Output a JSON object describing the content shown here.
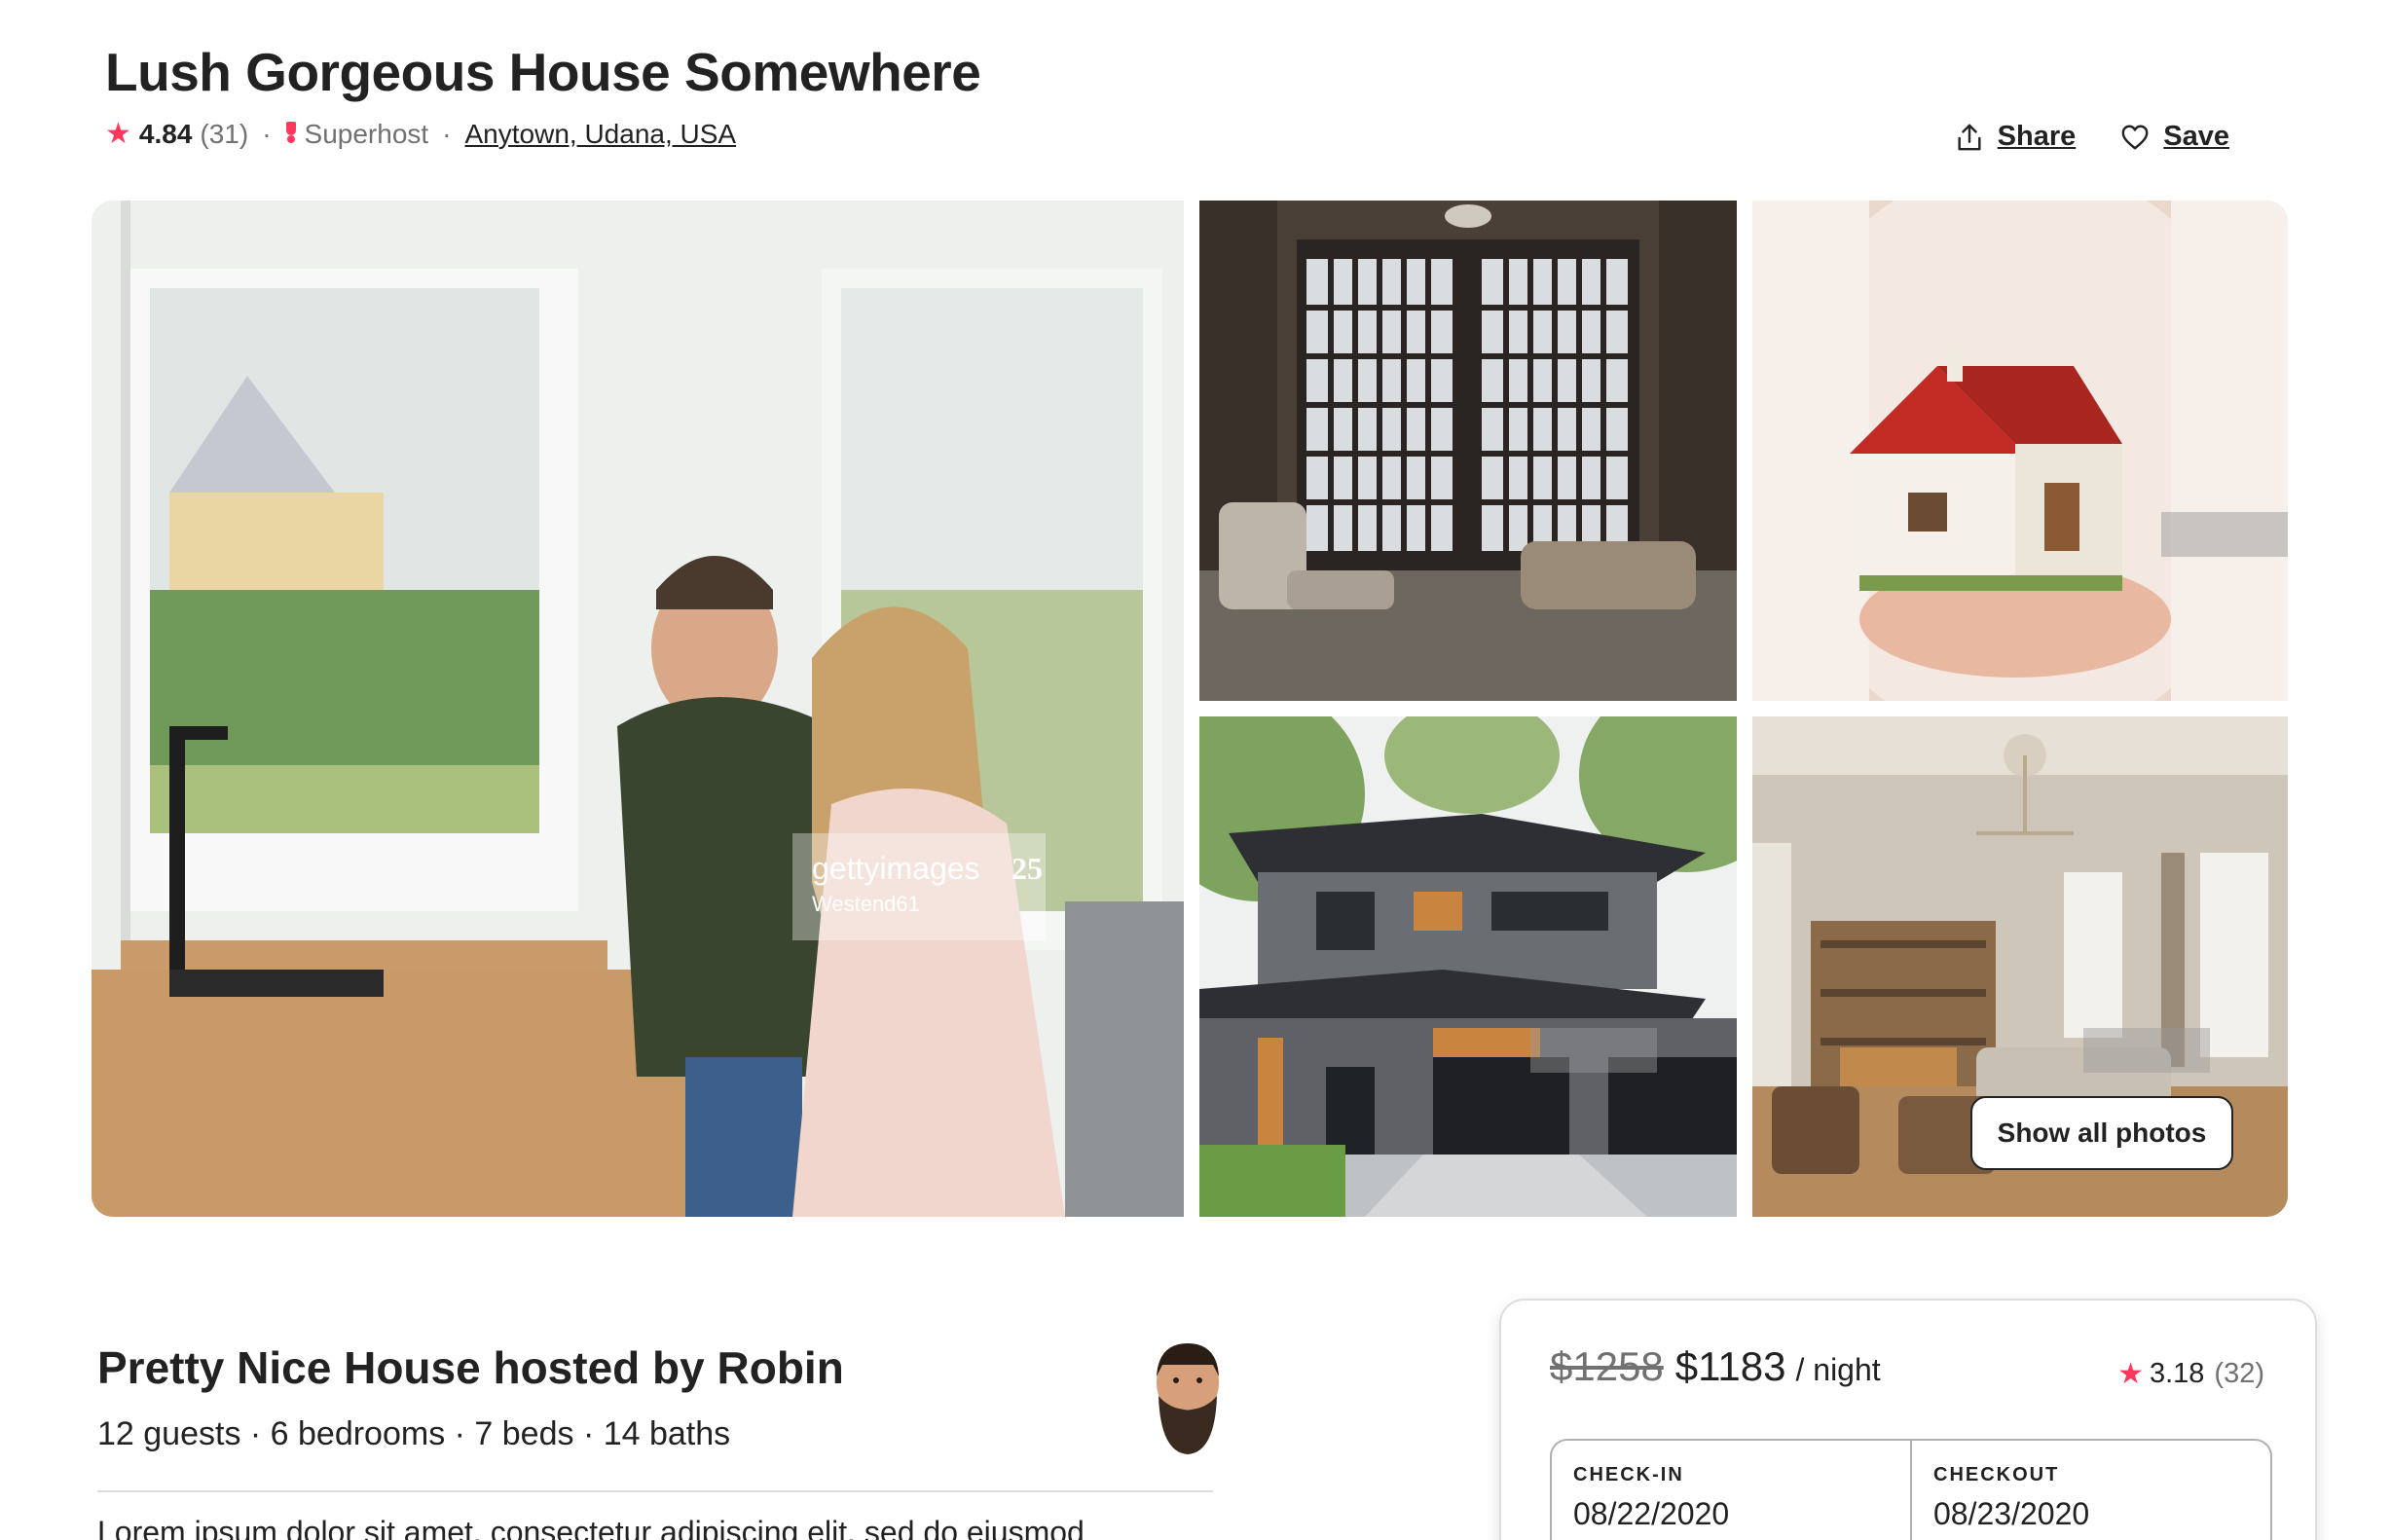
{
  "listing": {
    "title": "Lush Gorgeous House Somewhere",
    "rating": "4.84",
    "review_count": "(31)",
    "superhost_label": "Superhost",
    "location": "Anytown, Udana, USA",
    "separator": "·"
  },
  "actions": {
    "share_label": "Share",
    "save_label": "Save"
  },
  "gallery": {
    "show_all_label": "Show all photos",
    "watermark_main": "gettyimages",
    "watermark_main_sub": "Westend61",
    "watermark_years": "25"
  },
  "host": {
    "title": "Pretty Nice House hosted by Robin",
    "summary": "12 guests · 6 bedrooms · 7 beds · 14 baths",
    "description": "Lorem ipsum dolor sit amet, consectetur adipiscing elit, sed do eiusmod"
  },
  "booking": {
    "old_price": "$1258",
    "new_price": "$1183",
    "per_night": "/ night",
    "rating": "3.18",
    "review_count": "(32)",
    "checkin_label": "CHECK-IN",
    "checkin_value": "08/22/2020",
    "checkout_label": "CHECKOUT",
    "checkout_value": "08/23/2020"
  },
  "colors": {
    "accent": "#ff385c",
    "text": "#222222",
    "muted": "#717171"
  }
}
